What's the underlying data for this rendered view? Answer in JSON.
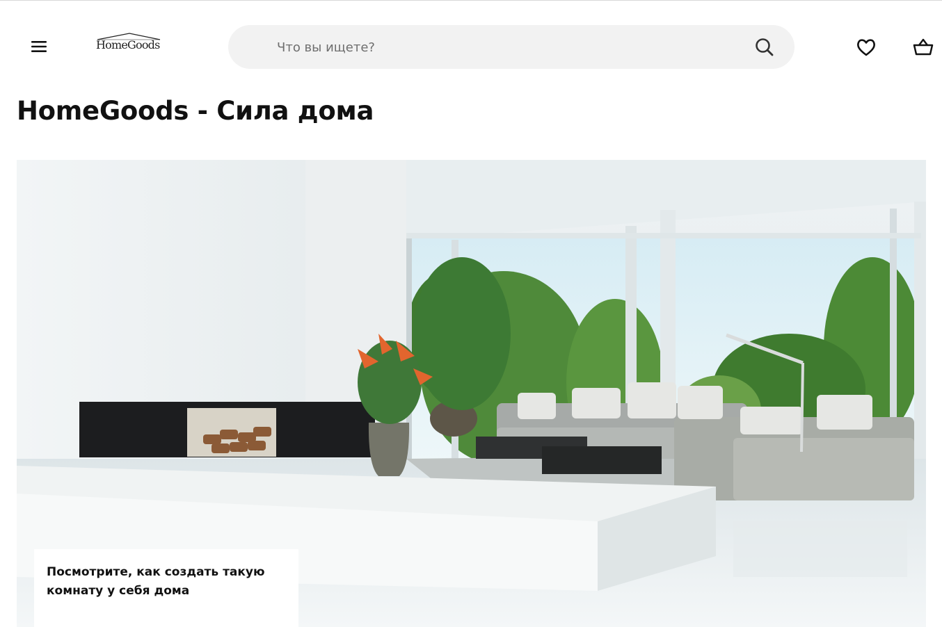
{
  "header": {
    "logo_text": "HomeGoods",
    "search": {
      "placeholder": "Что вы ищете?"
    },
    "icons": [
      "menu-icon",
      "search-icon",
      "heart-icon",
      "basket-icon"
    ]
  },
  "main": {
    "title": "HomeGoods - Сила дома",
    "hero": {
      "caption": "Посмотрите, как создать такую комнату у себя дома"
    }
  },
  "colors": {
    "search_bg": "#f2f2f2",
    "text": "#111111"
  }
}
